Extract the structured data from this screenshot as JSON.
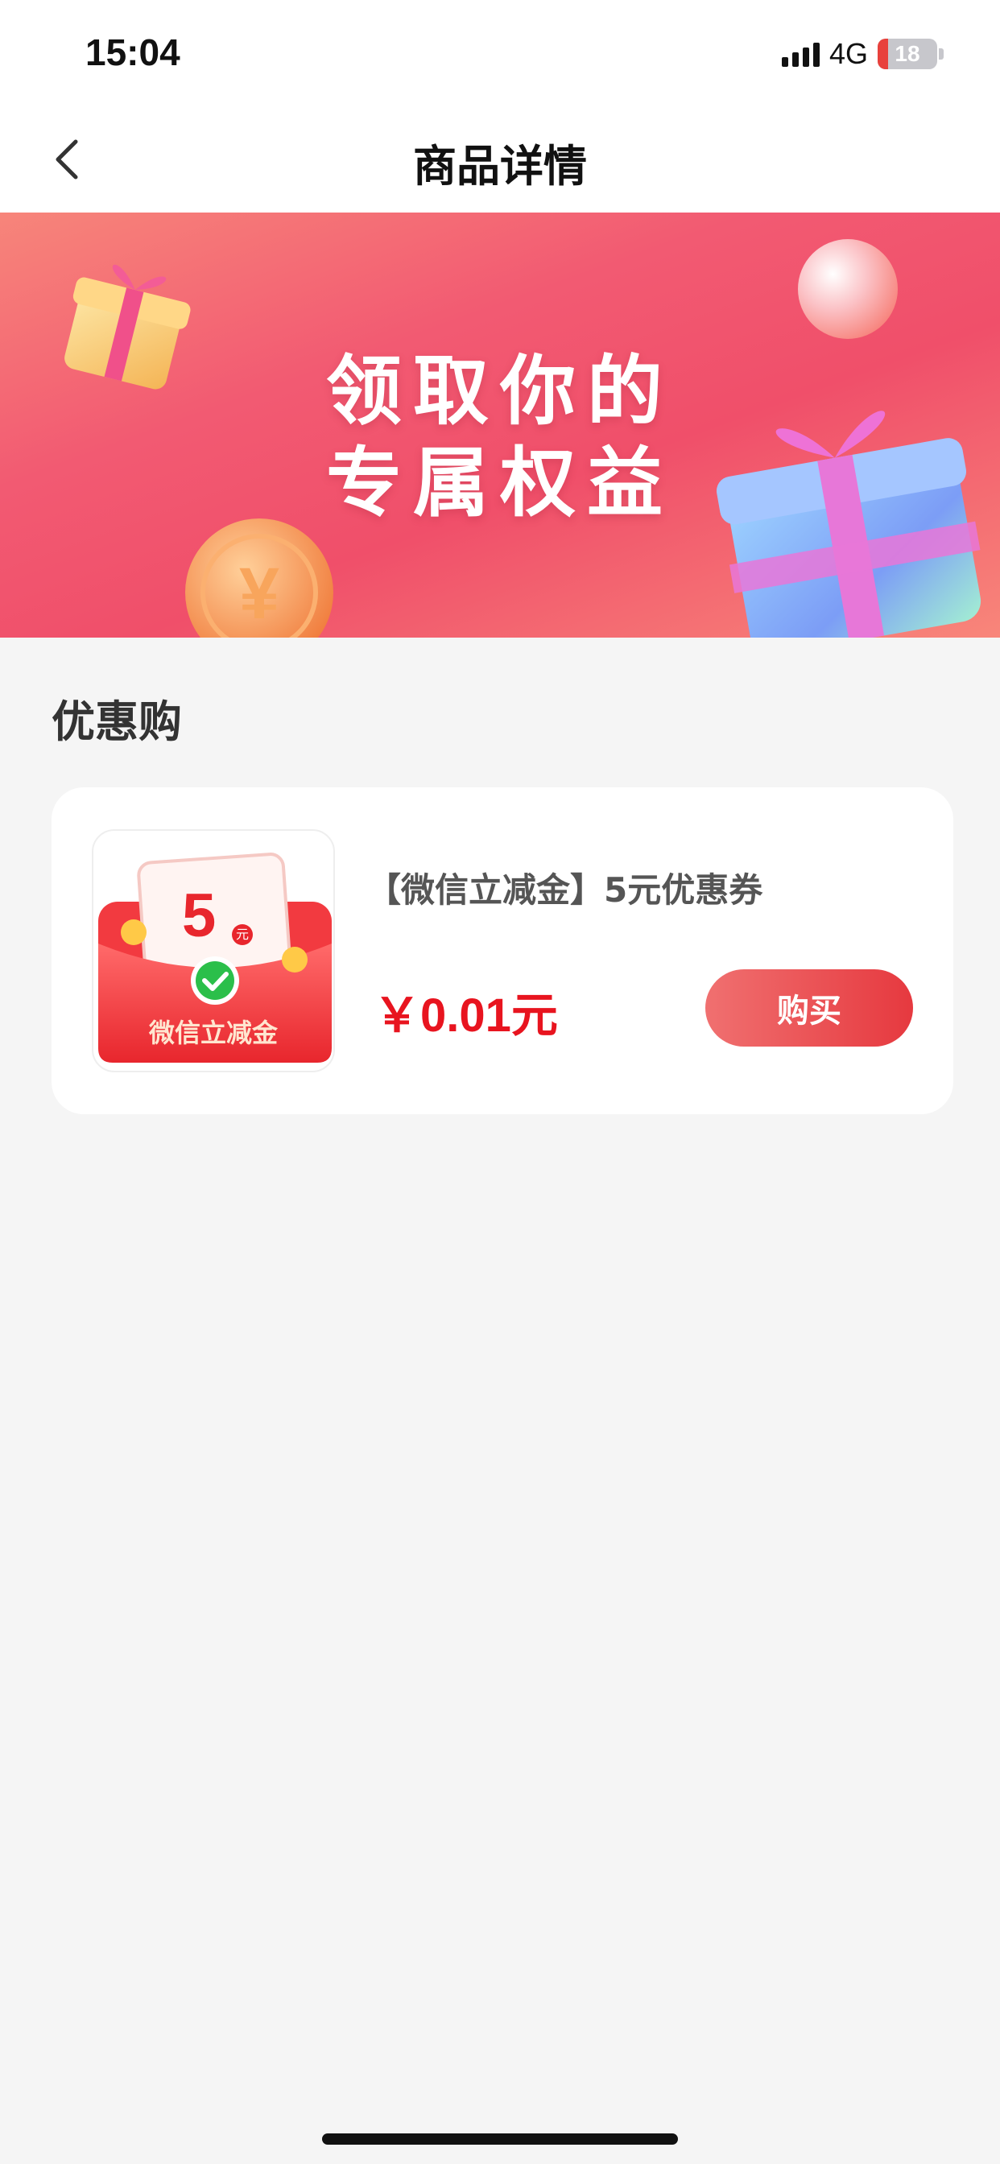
{
  "status_bar": {
    "time": "15:04",
    "network": "4G",
    "battery": "18",
    "battery_level": 0.18,
    "icons": [
      "signal-icon",
      "battery-charging-icon"
    ]
  },
  "nav": {
    "title": "商品详情",
    "back_icon": "chevron-left-icon"
  },
  "banner": {
    "line1": "领取你的",
    "line2": "专属权益",
    "decorations": [
      "gift-box-icon",
      "coin-icon",
      "bubble-icon"
    ],
    "colors": {
      "start": "#f7857a",
      "mid": "#f04f6a"
    }
  },
  "section": {
    "title": "优惠购"
  },
  "product": {
    "name": "【微信立减金】5元优惠券",
    "price": "￥0.01元",
    "buy_label": "购买",
    "thumb": {
      "amount": "5",
      "unit": "元",
      "caption": "微信立减金",
      "icon": "wechat-icon"
    },
    "colors": {
      "price": "#e8141f",
      "button": "#e6393f"
    }
  }
}
